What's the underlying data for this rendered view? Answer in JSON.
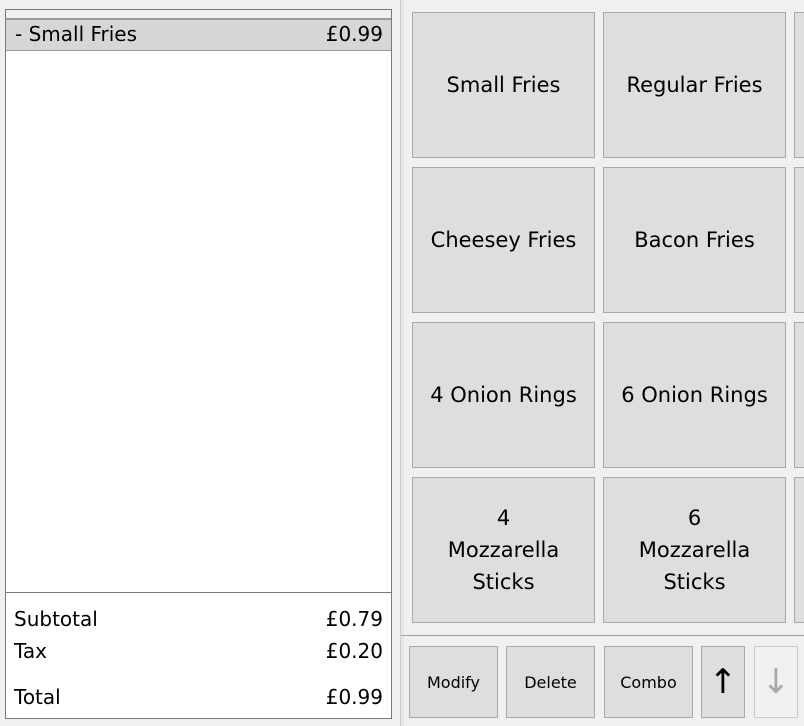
{
  "order": {
    "items": [
      {
        "name": "- Small Fries",
        "price": "£0.99"
      }
    ],
    "subtotal_label": "Subtotal",
    "subtotal_value": "£0.79",
    "tax_label": "Tax",
    "tax_value": "£0.20",
    "total_label": "Total",
    "total_value": "£0.99"
  },
  "products": [
    {
      "label": "Small Fries"
    },
    {
      "label": "Regular Fries"
    },
    {
      "label": "Cheesey Fries"
    },
    {
      "label": "Bacon Fries"
    },
    {
      "label": "4 Onion Rings"
    },
    {
      "label": "6 Onion Rings"
    },
    {
      "label": "4 Mozzarella Sticks"
    },
    {
      "label": "6 Mozzarella Sticks"
    }
  ],
  "actions": {
    "modify": "Modify",
    "delete": "Delete",
    "combo": "Combo",
    "up_icon": "↑",
    "down_icon": "↓"
  }
}
